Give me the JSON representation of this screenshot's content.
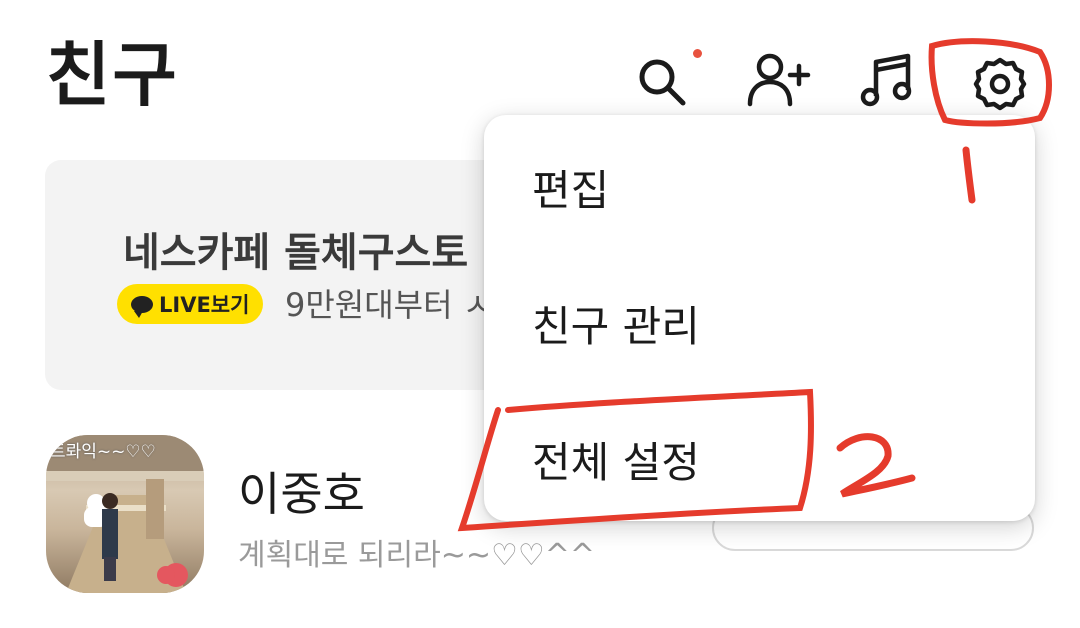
{
  "header": {
    "title": "친구",
    "icons": [
      "search-icon",
      "add-friend-icon",
      "music-icon",
      "settings-icon"
    ]
  },
  "banner": {
    "title": "네스카페 돌체구스토",
    "live_label": "LIVE보기",
    "subtitle": "9만원대부터 ㅅ"
  },
  "profile": {
    "name": "이중호",
    "status": "계획대로 되리라~~♡♡^^",
    "avatar_caption": "트롸익~~♡♡"
  },
  "menu": {
    "items": [
      "편집",
      "친구 관리",
      "전체 설정"
    ]
  },
  "annotations": {
    "step1": "1",
    "step2": "2"
  },
  "colors": {
    "accent_yellow": "#ffe000",
    "notification_dot": "#e8523f",
    "annotation_red": "#e53b2c"
  }
}
